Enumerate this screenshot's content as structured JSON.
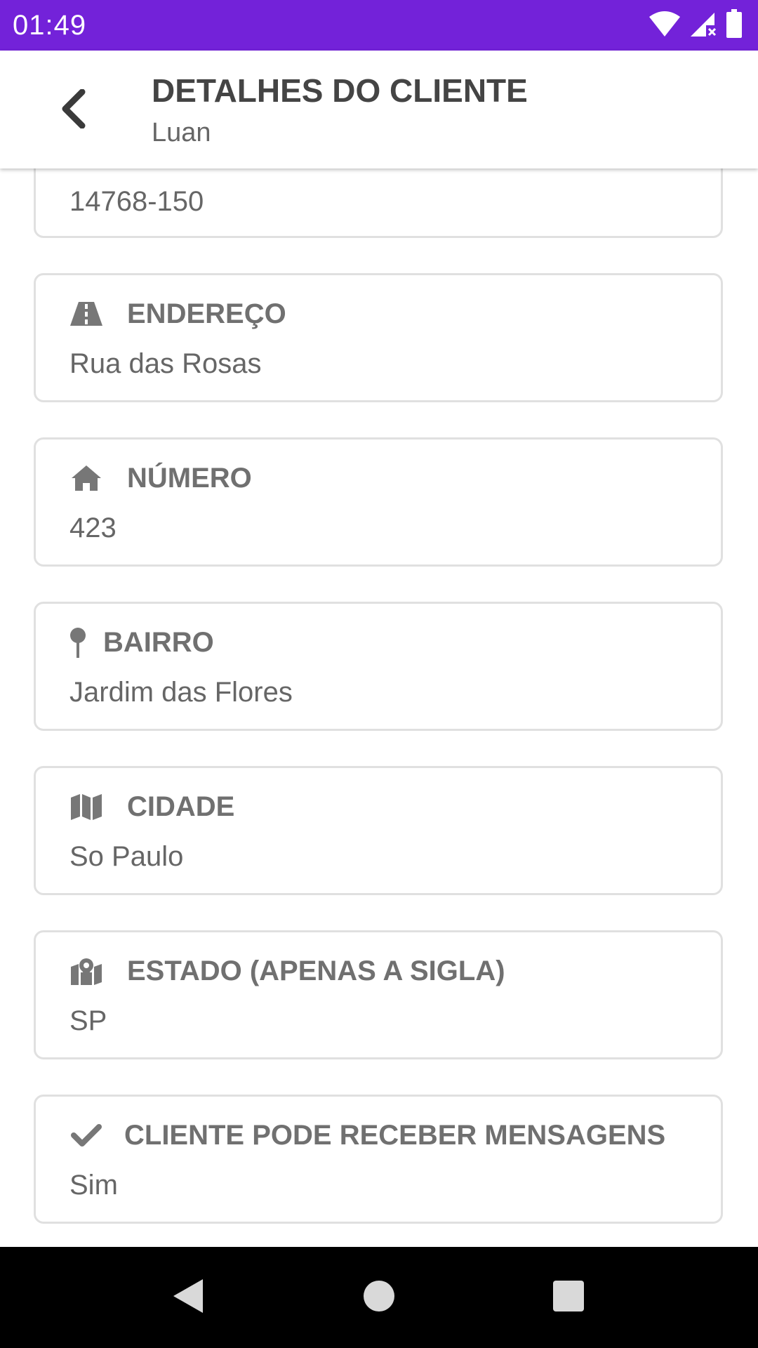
{
  "status_bar": {
    "time": "01:49"
  },
  "app_bar": {
    "title": "DETALHES DO CLIENTE",
    "subtitle": "Luan"
  },
  "cards": [
    {
      "label": "",
      "value": "14768-150",
      "icon": "none"
    },
    {
      "label": "ENDEREÇO",
      "value": "Rua das Rosas",
      "icon": "road-icon"
    },
    {
      "label": "NÚMERO",
      "value": "423",
      "icon": "home-icon"
    },
    {
      "label": "BAIRRO",
      "value": "Jardim das Flores",
      "icon": "map-pin-icon"
    },
    {
      "label": "CIDADE",
      "value": "So Paulo",
      "icon": "map-icon"
    },
    {
      "label": "ESTADO (APENAS A SIGLA)",
      "value": "SP",
      "icon": "map-marker-icon"
    },
    {
      "label": "CLIENTE PODE RECEBER MENSAGENS",
      "value": "Sim",
      "icon": "check-icon"
    }
  ],
  "colors": {
    "status_bar": "#7322d9",
    "label": "#707070",
    "value": "#666666",
    "border": "#e0e0e0"
  }
}
